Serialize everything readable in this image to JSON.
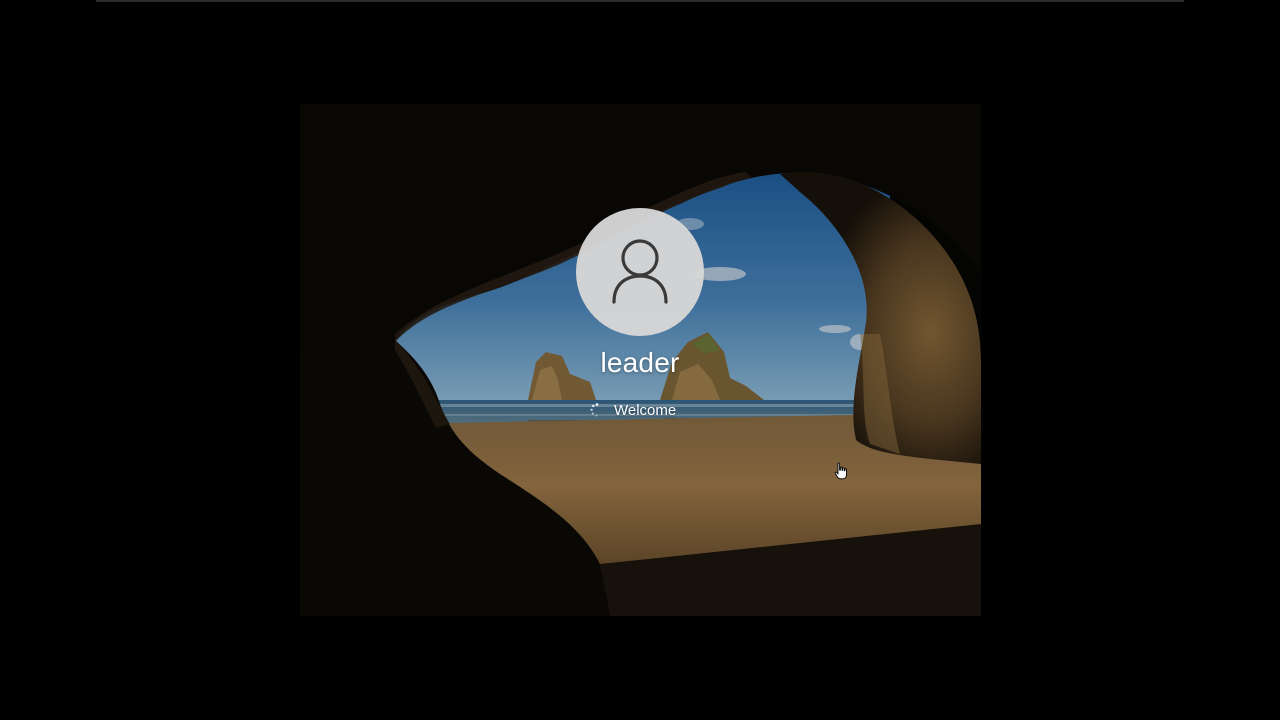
{
  "lock_screen": {
    "username": "leader",
    "status_text": "Welcome",
    "user_icon": "user-silhouette-icon",
    "spinner_icon": "loading-spinner-icon"
  },
  "colors": {
    "background": "#000000",
    "avatar_fill": "#d6d6d6",
    "avatar_icon": "#3a3a3a",
    "text": "#ffffff"
  },
  "pointer": {
    "icon": "hand-cursor-icon"
  }
}
